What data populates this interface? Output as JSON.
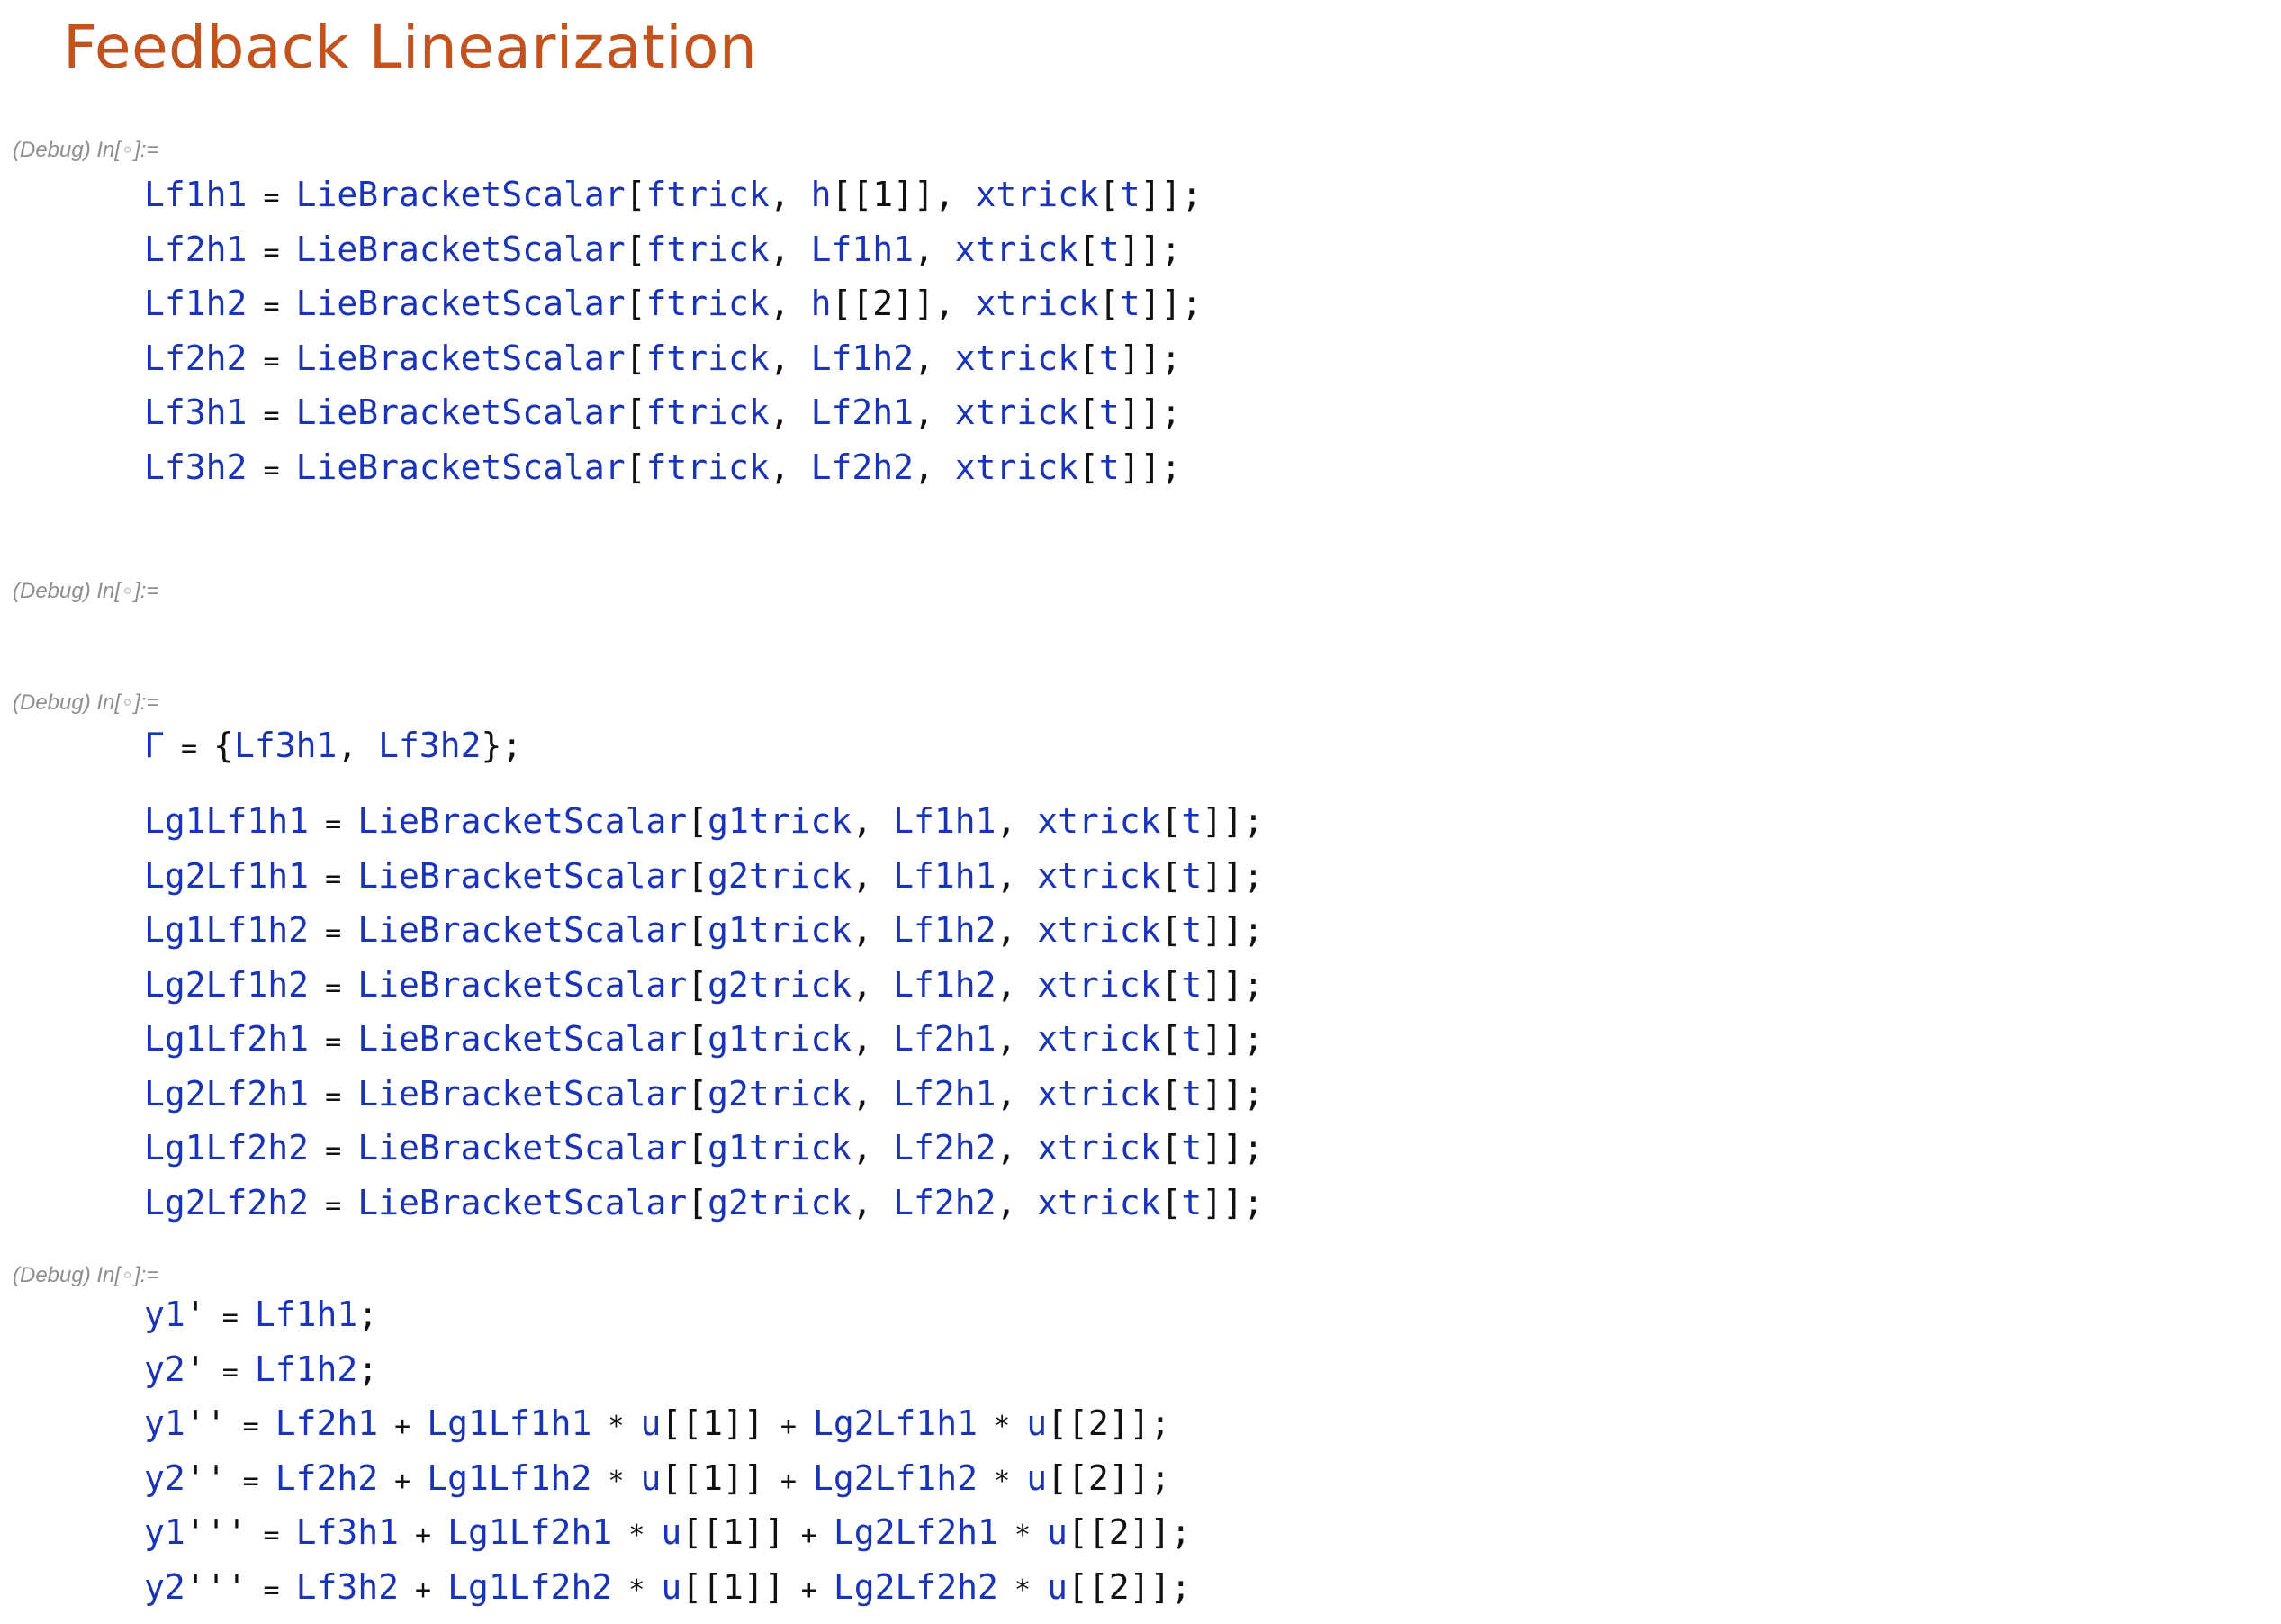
{
  "title": "Feedback Linearization",
  "cell_label": {
    "prefix": "(Debug) In[",
    "dot": "∘",
    "suffix": "]:="
  },
  "cells": [
    {
      "lines": [
        [
          [
            "s",
            "Lf1h1"
          ],
          [
            "o",
            " = "
          ],
          [
            "s",
            "LieBracketScalar"
          ],
          [
            "p",
            "["
          ],
          [
            "s",
            "ftrick"
          ],
          [
            "p",
            ", "
          ],
          [
            "s",
            "h"
          ],
          [
            "p",
            "[[1]], "
          ],
          [
            "s",
            "xtrick"
          ],
          [
            "p",
            "["
          ],
          [
            "s",
            "t"
          ],
          [
            "p",
            "]];"
          ]
        ],
        [
          [
            "s",
            "Lf2h1"
          ],
          [
            "o",
            " = "
          ],
          [
            "s",
            "LieBracketScalar"
          ],
          [
            "p",
            "["
          ],
          [
            "s",
            "ftrick"
          ],
          [
            "p",
            ", "
          ],
          [
            "s",
            "Lf1h1"
          ],
          [
            "p",
            ", "
          ],
          [
            "s",
            "xtrick"
          ],
          [
            "p",
            "["
          ],
          [
            "s",
            "t"
          ],
          [
            "p",
            "]];"
          ]
        ],
        [
          [
            "s",
            "Lf1h2"
          ],
          [
            "o",
            " = "
          ],
          [
            "s",
            "LieBracketScalar"
          ],
          [
            "p",
            "["
          ],
          [
            "s",
            "ftrick"
          ],
          [
            "p",
            ", "
          ],
          [
            "s",
            "h"
          ],
          [
            "p",
            "[[2]], "
          ],
          [
            "s",
            "xtrick"
          ],
          [
            "p",
            "["
          ],
          [
            "s",
            "t"
          ],
          [
            "p",
            "]];"
          ]
        ],
        [
          [
            "s",
            "Lf2h2"
          ],
          [
            "o",
            " = "
          ],
          [
            "s",
            "LieBracketScalar"
          ],
          [
            "p",
            "["
          ],
          [
            "s",
            "ftrick"
          ],
          [
            "p",
            ", "
          ],
          [
            "s",
            "Lf1h2"
          ],
          [
            "p",
            ", "
          ],
          [
            "s",
            "xtrick"
          ],
          [
            "p",
            "["
          ],
          [
            "s",
            "t"
          ],
          [
            "p",
            "]];"
          ]
        ],
        [
          [
            "s",
            "Lf3h1"
          ],
          [
            "o",
            " = "
          ],
          [
            "s",
            "LieBracketScalar"
          ],
          [
            "p",
            "["
          ],
          [
            "s",
            "ftrick"
          ],
          [
            "p",
            ", "
          ],
          [
            "s",
            "Lf2h1"
          ],
          [
            "p",
            ", "
          ],
          [
            "s",
            "xtrick"
          ],
          [
            "p",
            "["
          ],
          [
            "s",
            "t"
          ],
          [
            "p",
            "]];"
          ]
        ],
        [
          [
            "s",
            "Lf3h2"
          ],
          [
            "o",
            " = "
          ],
          [
            "s",
            "LieBracketScalar"
          ],
          [
            "p",
            "["
          ],
          [
            "s",
            "ftrick"
          ],
          [
            "p",
            ", "
          ],
          [
            "s",
            "Lf2h2"
          ],
          [
            "p",
            ", "
          ],
          [
            "s",
            "xtrick"
          ],
          [
            "p",
            "["
          ],
          [
            "s",
            "t"
          ],
          [
            "p",
            "]];"
          ]
        ]
      ]
    },
    {
      "lines": []
    },
    {
      "lines": [
        [
          [
            "s",
            "Γ"
          ],
          [
            "o",
            " = "
          ],
          [
            "p",
            "{"
          ],
          [
            "s",
            "Lf3h1"
          ],
          [
            "p",
            ", "
          ],
          [
            "s",
            "Lf3h2"
          ],
          [
            "p",
            "};"
          ]
        ]
      ]
    },
    {
      "lines": [
        [
          [
            "s",
            "Lg1Lf1h1"
          ],
          [
            "o",
            " = "
          ],
          [
            "s",
            "LieBracketScalar"
          ],
          [
            "p",
            "["
          ],
          [
            "s",
            "g1trick"
          ],
          [
            "p",
            ", "
          ],
          [
            "s",
            "Lf1h1"
          ],
          [
            "p",
            ", "
          ],
          [
            "s",
            "xtrick"
          ],
          [
            "p",
            "["
          ],
          [
            "s",
            "t"
          ],
          [
            "p",
            "]];"
          ]
        ],
        [
          [
            "s",
            "Lg2Lf1h1"
          ],
          [
            "o",
            " = "
          ],
          [
            "s",
            "LieBracketScalar"
          ],
          [
            "p",
            "["
          ],
          [
            "s",
            "g2trick"
          ],
          [
            "p",
            ", "
          ],
          [
            "s",
            "Lf1h1"
          ],
          [
            "p",
            ", "
          ],
          [
            "s",
            "xtrick"
          ],
          [
            "p",
            "["
          ],
          [
            "s",
            "t"
          ],
          [
            "p",
            "]];"
          ]
        ],
        [
          [
            "s",
            "Lg1Lf1h2"
          ],
          [
            "o",
            " = "
          ],
          [
            "s",
            "LieBracketScalar"
          ],
          [
            "p",
            "["
          ],
          [
            "s",
            "g1trick"
          ],
          [
            "p",
            ", "
          ],
          [
            "s",
            "Lf1h2"
          ],
          [
            "p",
            ", "
          ],
          [
            "s",
            "xtrick"
          ],
          [
            "p",
            "["
          ],
          [
            "s",
            "t"
          ],
          [
            "p",
            "]];"
          ]
        ],
        [
          [
            "s",
            "Lg2Lf1h2"
          ],
          [
            "o",
            " = "
          ],
          [
            "s",
            "LieBracketScalar"
          ],
          [
            "p",
            "["
          ],
          [
            "s",
            "g2trick"
          ],
          [
            "p",
            ", "
          ],
          [
            "s",
            "Lf1h2"
          ],
          [
            "p",
            ", "
          ],
          [
            "s",
            "xtrick"
          ],
          [
            "p",
            "["
          ],
          [
            "s",
            "t"
          ],
          [
            "p",
            "]];"
          ]
        ],
        [
          [
            "s",
            "Lg1Lf2h1"
          ],
          [
            "o",
            " = "
          ],
          [
            "s",
            "LieBracketScalar"
          ],
          [
            "p",
            "["
          ],
          [
            "s",
            "g1trick"
          ],
          [
            "p",
            ", "
          ],
          [
            "s",
            "Lf2h1"
          ],
          [
            "p",
            ", "
          ],
          [
            "s",
            "xtrick"
          ],
          [
            "p",
            "["
          ],
          [
            "s",
            "t"
          ],
          [
            "p",
            "]];"
          ]
        ],
        [
          [
            "s",
            "Lg2Lf2h1"
          ],
          [
            "o",
            " = "
          ],
          [
            "s",
            "LieBracketScalar"
          ],
          [
            "p",
            "["
          ],
          [
            "s",
            "g2trick"
          ],
          [
            "p",
            ", "
          ],
          [
            "s",
            "Lf2h1"
          ],
          [
            "p",
            ", "
          ],
          [
            "s",
            "xtrick"
          ],
          [
            "p",
            "["
          ],
          [
            "s",
            "t"
          ],
          [
            "p",
            "]];"
          ]
        ],
        [
          [
            "s",
            "Lg1Lf2h2"
          ],
          [
            "o",
            " = "
          ],
          [
            "s",
            "LieBracketScalar"
          ],
          [
            "p",
            "["
          ],
          [
            "s",
            "g1trick"
          ],
          [
            "p",
            ", "
          ],
          [
            "s",
            "Lf2h2"
          ],
          [
            "p",
            ", "
          ],
          [
            "s",
            "xtrick"
          ],
          [
            "p",
            "["
          ],
          [
            "s",
            "t"
          ],
          [
            "p",
            "]];"
          ]
        ],
        [
          [
            "s",
            "Lg2Lf2h2"
          ],
          [
            "o",
            " = "
          ],
          [
            "s",
            "LieBracketScalar"
          ],
          [
            "p",
            "["
          ],
          [
            "s",
            "g2trick"
          ],
          [
            "p",
            ", "
          ],
          [
            "s",
            "Lf2h2"
          ],
          [
            "p",
            ", "
          ],
          [
            "s",
            "xtrick"
          ],
          [
            "p",
            "["
          ],
          [
            "s",
            "t"
          ],
          [
            "p",
            "]];"
          ]
        ]
      ]
    },
    {
      "lines": [
        [
          [
            "s",
            "y1"
          ],
          [
            "p",
            "'"
          ],
          [
            "o",
            " = "
          ],
          [
            "s",
            "Lf1h1"
          ],
          [
            "p",
            ";"
          ]
        ],
        [
          [
            "s",
            "y2"
          ],
          [
            "p",
            "'"
          ],
          [
            "o",
            " = "
          ],
          [
            "s",
            "Lf1h2"
          ],
          [
            "p",
            ";"
          ]
        ],
        [
          [
            "s",
            "y1"
          ],
          [
            "p",
            "''"
          ],
          [
            "o",
            " = "
          ],
          [
            "s",
            "Lf2h1"
          ],
          [
            "o",
            " + "
          ],
          [
            "s",
            "Lg1Lf1h1"
          ],
          [
            "o",
            " * "
          ],
          [
            "s",
            "u"
          ],
          [
            "p",
            "[[1]]"
          ],
          [
            "o",
            " + "
          ],
          [
            "s",
            "Lg2Lf1h1"
          ],
          [
            "o",
            " * "
          ],
          [
            "s",
            "u"
          ],
          [
            "p",
            "[[2]];"
          ]
        ],
        [
          [
            "s",
            "y2"
          ],
          [
            "p",
            "''"
          ],
          [
            "o",
            " = "
          ],
          [
            "s",
            "Lf2h2"
          ],
          [
            "o",
            " + "
          ],
          [
            "s",
            "Lg1Lf1h2"
          ],
          [
            "o",
            " * "
          ],
          [
            "s",
            "u"
          ],
          [
            "p",
            "[[1]]"
          ],
          [
            "o",
            " + "
          ],
          [
            "s",
            "Lg2Lf1h2"
          ],
          [
            "o",
            " * "
          ],
          [
            "s",
            "u"
          ],
          [
            "p",
            "[[2]];"
          ]
        ],
        [
          [
            "s",
            "y1"
          ],
          [
            "p",
            "'''"
          ],
          [
            "o",
            " = "
          ],
          [
            "s",
            "Lf3h1"
          ],
          [
            "o",
            " + "
          ],
          [
            "s",
            "Lg1Lf2h1"
          ],
          [
            "o",
            " * "
          ],
          [
            "s",
            "u"
          ],
          [
            "p",
            "[[1]]"
          ],
          [
            "o",
            " + "
          ],
          [
            "s",
            "Lg2Lf2h1"
          ],
          [
            "o",
            " * "
          ],
          [
            "s",
            "u"
          ],
          [
            "p",
            "[[2]];"
          ]
        ],
        [
          [
            "s",
            "y2"
          ],
          [
            "p",
            "'''"
          ],
          [
            "o",
            " = "
          ],
          [
            "s",
            "Lf3h2"
          ],
          [
            "o",
            " + "
          ],
          [
            "s",
            "Lg1Lf2h2"
          ],
          [
            "o",
            " * "
          ],
          [
            "s",
            "u"
          ],
          [
            "p",
            "[[1]]"
          ],
          [
            "o",
            " + "
          ],
          [
            "s",
            "Lg2Lf2h2"
          ],
          [
            "o",
            " * "
          ],
          [
            "s",
            "u"
          ],
          [
            "p",
            "[[2]];"
          ]
        ]
      ]
    }
  ],
  "colors": {
    "title": "#c2531f",
    "symbol": "#1a34b8",
    "label": "#8e8e8e"
  }
}
